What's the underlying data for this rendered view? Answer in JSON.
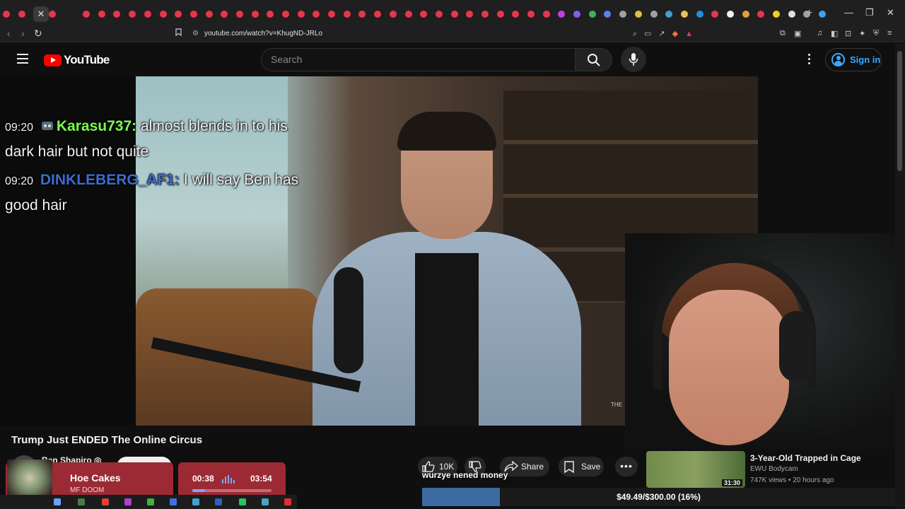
{
  "browser": {
    "url": "youtube.com/watch?v=KhugND-JRLo",
    "tab_close": "✕",
    "new_tab": "+",
    "window_controls": [
      "—",
      "❐",
      "✕"
    ],
    "nav": {
      "back": "‹",
      "forward": "›",
      "reload": "↻"
    },
    "bookmark_icon": "bookmark-icon",
    "colors": {
      "chrome": "#1f1f1f"
    }
  },
  "youtube": {
    "logo_text": "YouTube",
    "search_placeholder": "Search",
    "signin_label": "Sign in",
    "brand_color": "#ff0000",
    "link_color": "#3ea6ff"
  },
  "chat": [
    {
      "time": "09:20",
      "user": "Karasu737:",
      "message": "almost blends in to his dark hair but not quite",
      "user_color": "#7cff4c"
    },
    {
      "time": "09:20",
      "user": "DINKLEBERG_AF1:",
      "message": "I will say Ben has good hair",
      "user_color": "#3b6ccf"
    }
  ],
  "video": {
    "watermark": "THE",
    "title": "Trump Just ENDED The Online Circus",
    "channel": "Ben Shapiro ◎"
  },
  "actions": {
    "like_count": "10K",
    "share_label": "Share",
    "save_label": "Save",
    "more_label": "•••"
  },
  "caption": "wurzye nened money",
  "recommended": {
    "title": "3-Year-Old Trapped in Cage",
    "channel": "EWU Bodycam",
    "meta": "747K views • 20 hours ago",
    "duration": "31:30"
  },
  "now_playing": {
    "title": "Hoe Cakes",
    "artist": "MF DOOM",
    "current_time": "00:38",
    "total_time": "03:54",
    "progress_fraction": 0.16
  },
  "donation_goal": {
    "text": "$49.49/$300.00 (16%)",
    "fraction": 0.165,
    "fill_color": "#3d6aa0"
  }
}
